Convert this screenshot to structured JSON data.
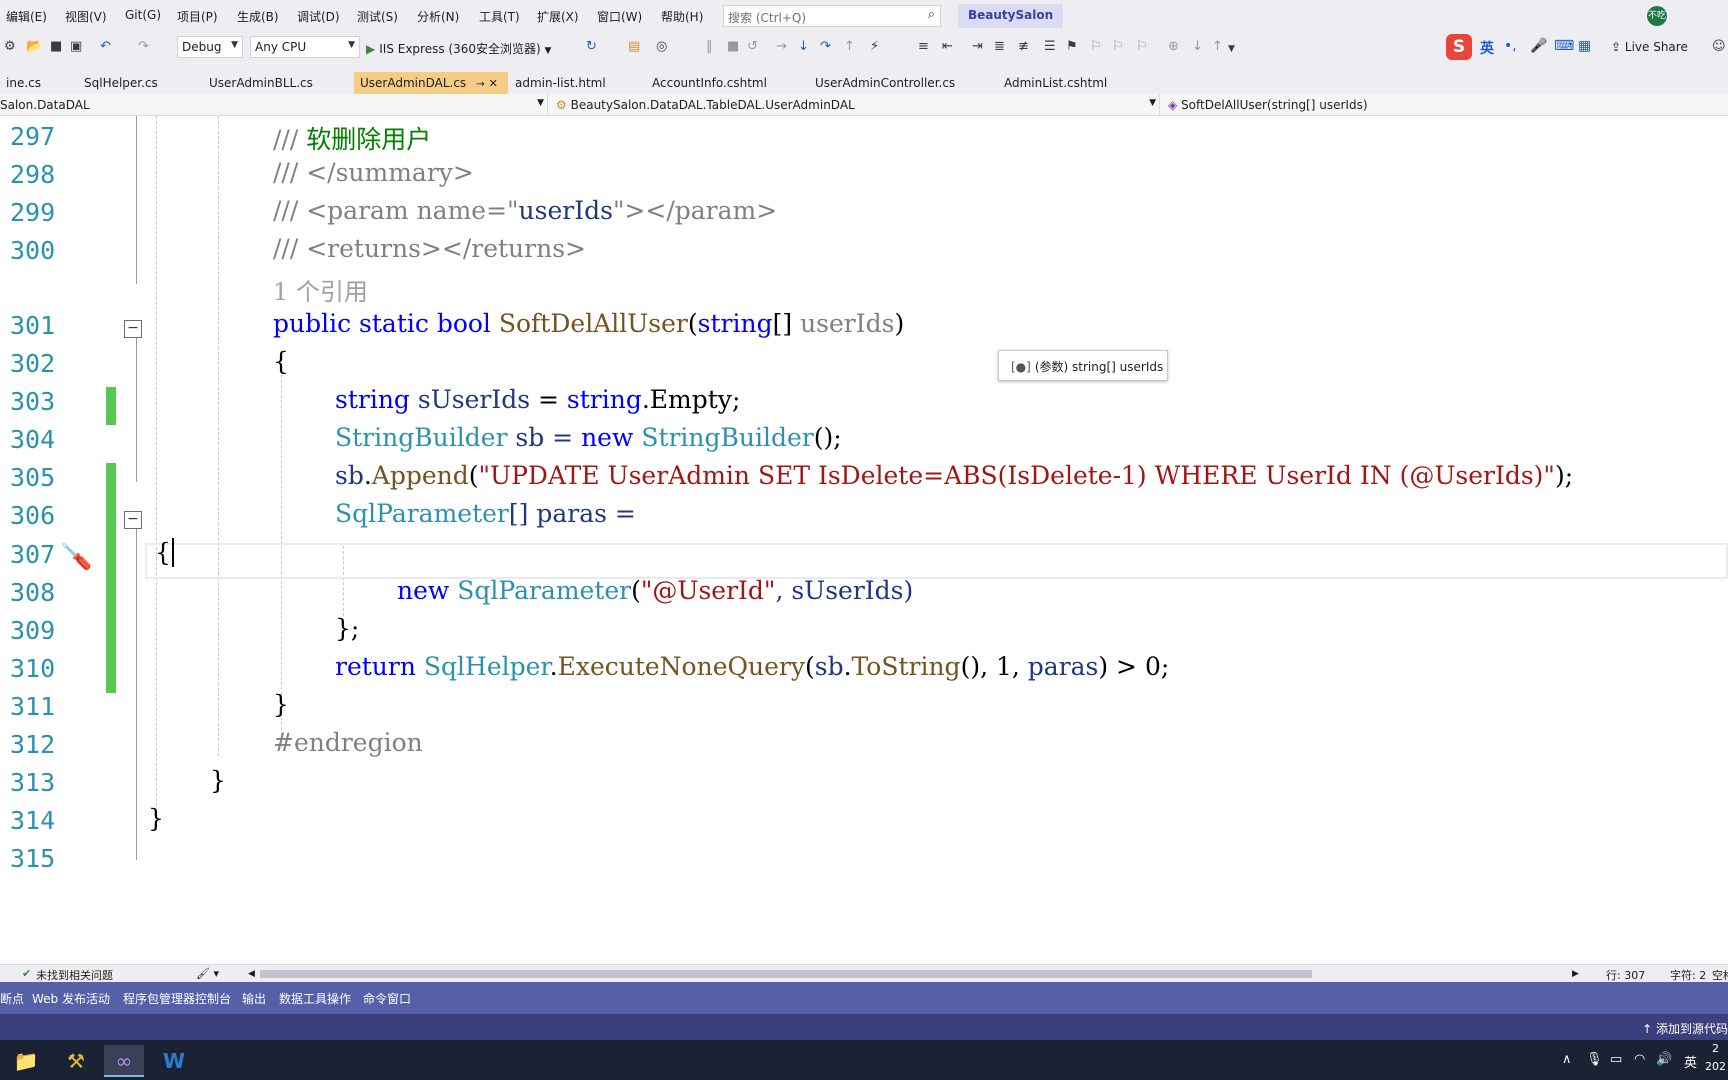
{
  "menubar": {
    "items": [
      "编辑(E)",
      "视图(V)",
      "Git(G)",
      "项目(P)",
      "生成(B)",
      "调试(D)",
      "测试(S)",
      "分析(N)",
      "工具(T)",
      "扩展(X)",
      "窗口(W)",
      "帮助(H)"
    ],
    "search_placeholder": "搜索 (Ctrl+Q)",
    "solution_name": "BeautySalon",
    "avatar_text": "不吃"
  },
  "toolbar": {
    "configuration": "Debug",
    "platform": "Any CPU",
    "run_target": "IIS Express (360安全浏览器)",
    "live_share": "Live Share",
    "ime_lang": "英"
  },
  "tabs": [
    {
      "label": "ine.cs",
      "active": false
    },
    {
      "label": "SqlHelper.cs",
      "active": false
    },
    {
      "label": "UserAdminBLL.cs",
      "active": false
    },
    {
      "label": "UserAdminDAL.cs",
      "active": true
    },
    {
      "label": "admin-list.html",
      "active": false
    },
    {
      "label": "AccountInfo.cshtml",
      "active": false
    },
    {
      "label": "UserAdminController.cs",
      "active": false
    },
    {
      "label": "AdminList.cshtml",
      "active": false
    }
  ],
  "navbar": {
    "project": "Salon.DataDAL",
    "class": "BeautySalon.DataDAL.TableDAL.UserAdminDAL",
    "member": "SoftDelAllUser(string[] userIds)"
  },
  "editor": {
    "line_numbers": [
      "297",
      "298",
      "299",
      "300",
      "301",
      "302",
      "303",
      "304",
      "305",
      "306",
      "307",
      "308",
      "309",
      "310",
      "311",
      "312",
      "313",
      "314",
      "315"
    ],
    "codelens": "1 个引用",
    "tooltip": "(参数) string[] userIds",
    "lines": {
      "l297": {
        "a": "/// ",
        "b": "软删除用户"
      },
      "l298": {
        "a": "/// </summary>"
      },
      "l299": {
        "a": "/// <param name=\"",
        "b": "userIds",
        "c": "\"></param>"
      },
      "l300": {
        "a": "/// <returns></returns>"
      },
      "l301": {
        "a": "public static bool ",
        "b": "SoftDelAllUser",
        "c": "(",
        "d": "string",
        "e": "[] ",
        "f": "userIds",
        "g": ")"
      },
      "l302": {
        "a": "{"
      },
      "l303": {
        "a": "string ",
        "b": "sUserIds",
        "c": " = ",
        "d": "string",
        "e": ".",
        "f": "Empty",
        "g": ";"
      },
      "l304": {
        "a": "StringBuilder",
        "b": " sb = ",
        "c": "new ",
        "d": "StringBuilder",
        "e": "();"
      },
      "l305": {
        "a": "sb",
        "b": ".",
        "c": "Append",
        "d": "(",
        "e": "\"UPDATE UserAdmin SET IsDelete=ABS(IsDelete-1) WHERE UserId IN (@UserIds)\"",
        "f": ");"
      },
      "l306": {
        "a": "SqlParameter",
        "b": "[] paras ="
      },
      "l307": {
        "a": "{"
      },
      "l308": {
        "a": "new ",
        "b": "SqlParameter",
        "c": "(",
        "d": "\"@UserId\"",
        "e": ", sUserIds)"
      },
      "l309": {
        "a": "};"
      },
      "l310": {
        "a": "return ",
        "b": "SqlHelper",
        "c": ".",
        "d": "ExecuteNoneQuery",
        "e": "(",
        "f": "sb",
        "g": ".",
        "h": "ToString",
        "i": "(), 1, ",
        "j": "paras",
        "k": ") > 0;"
      },
      "l311": {
        "a": "}"
      },
      "l312": {
        "a": "#endregion"
      },
      "l313": {
        "a": "}"
      },
      "l314": {
        "a": "}"
      }
    }
  },
  "statusstrip": {
    "issues": "未找到相关问题",
    "line": "行: 307",
    "char": "字符: 2",
    "extra": "空格"
  },
  "bottomtabs": [
    "断点",
    "Web 发布活动",
    "程序包管理器控制台",
    "输出",
    "数据工具操作",
    "命令窗口"
  ],
  "vsstatus": {
    "source_control": "添加到源代码"
  },
  "taskbar": {
    "tray_lang": "英",
    "clock_top": "2",
    "clock_bottom": "202"
  },
  "colors": {
    "keyword": "#0000ff",
    "type": "#2b91af",
    "method": "#74531f",
    "string": "#a31515",
    "comment": "#008000",
    "change_bar": "#57c84d",
    "active_tab": "#f5cc84",
    "tool_strip": "#5560a8"
  }
}
